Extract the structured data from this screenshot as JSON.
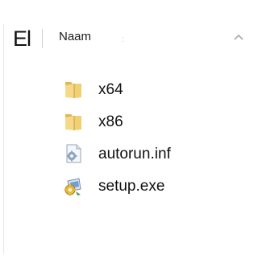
{
  "header": {
    "partial_label": "El",
    "name_column_label": "Naam",
    "resize_grip": ":"
  },
  "files": [
    {
      "name": "x64",
      "icon": "folder-icon"
    },
    {
      "name": "x86",
      "icon": "folder-icon"
    },
    {
      "name": "autorun.inf",
      "icon": "settings-file-icon"
    },
    {
      "name": "setup.exe",
      "icon": "setup-exe-icon"
    }
  ],
  "colors": {
    "folder_front": "#f5d98b",
    "folder_back": "#e2b64d",
    "text": "#111111"
  }
}
